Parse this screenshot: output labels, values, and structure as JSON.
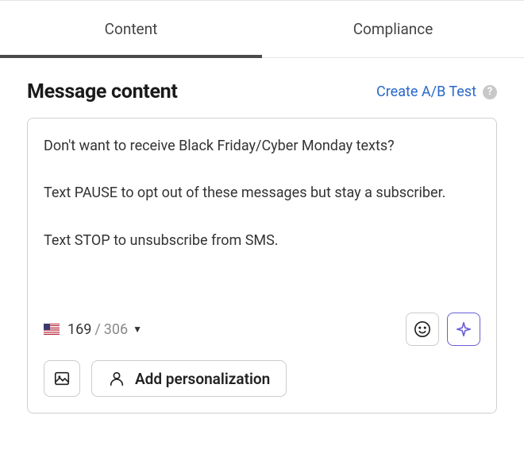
{
  "tabs": {
    "content": "Content",
    "compliance": "Compliance"
  },
  "section": {
    "title": "Message content"
  },
  "abtest": {
    "label": "Create A/B Test"
  },
  "message": {
    "body": "Don't want to receive Black Friday/Cyber Monday texts?\n\nText PAUSE to opt out of these messages but stay a subscriber.\n\nText STOP to unsubscribe from SMS."
  },
  "counter": {
    "current": "169",
    "separator": "/",
    "max": "306"
  },
  "buttons": {
    "add_personalization": "Add personalization"
  }
}
